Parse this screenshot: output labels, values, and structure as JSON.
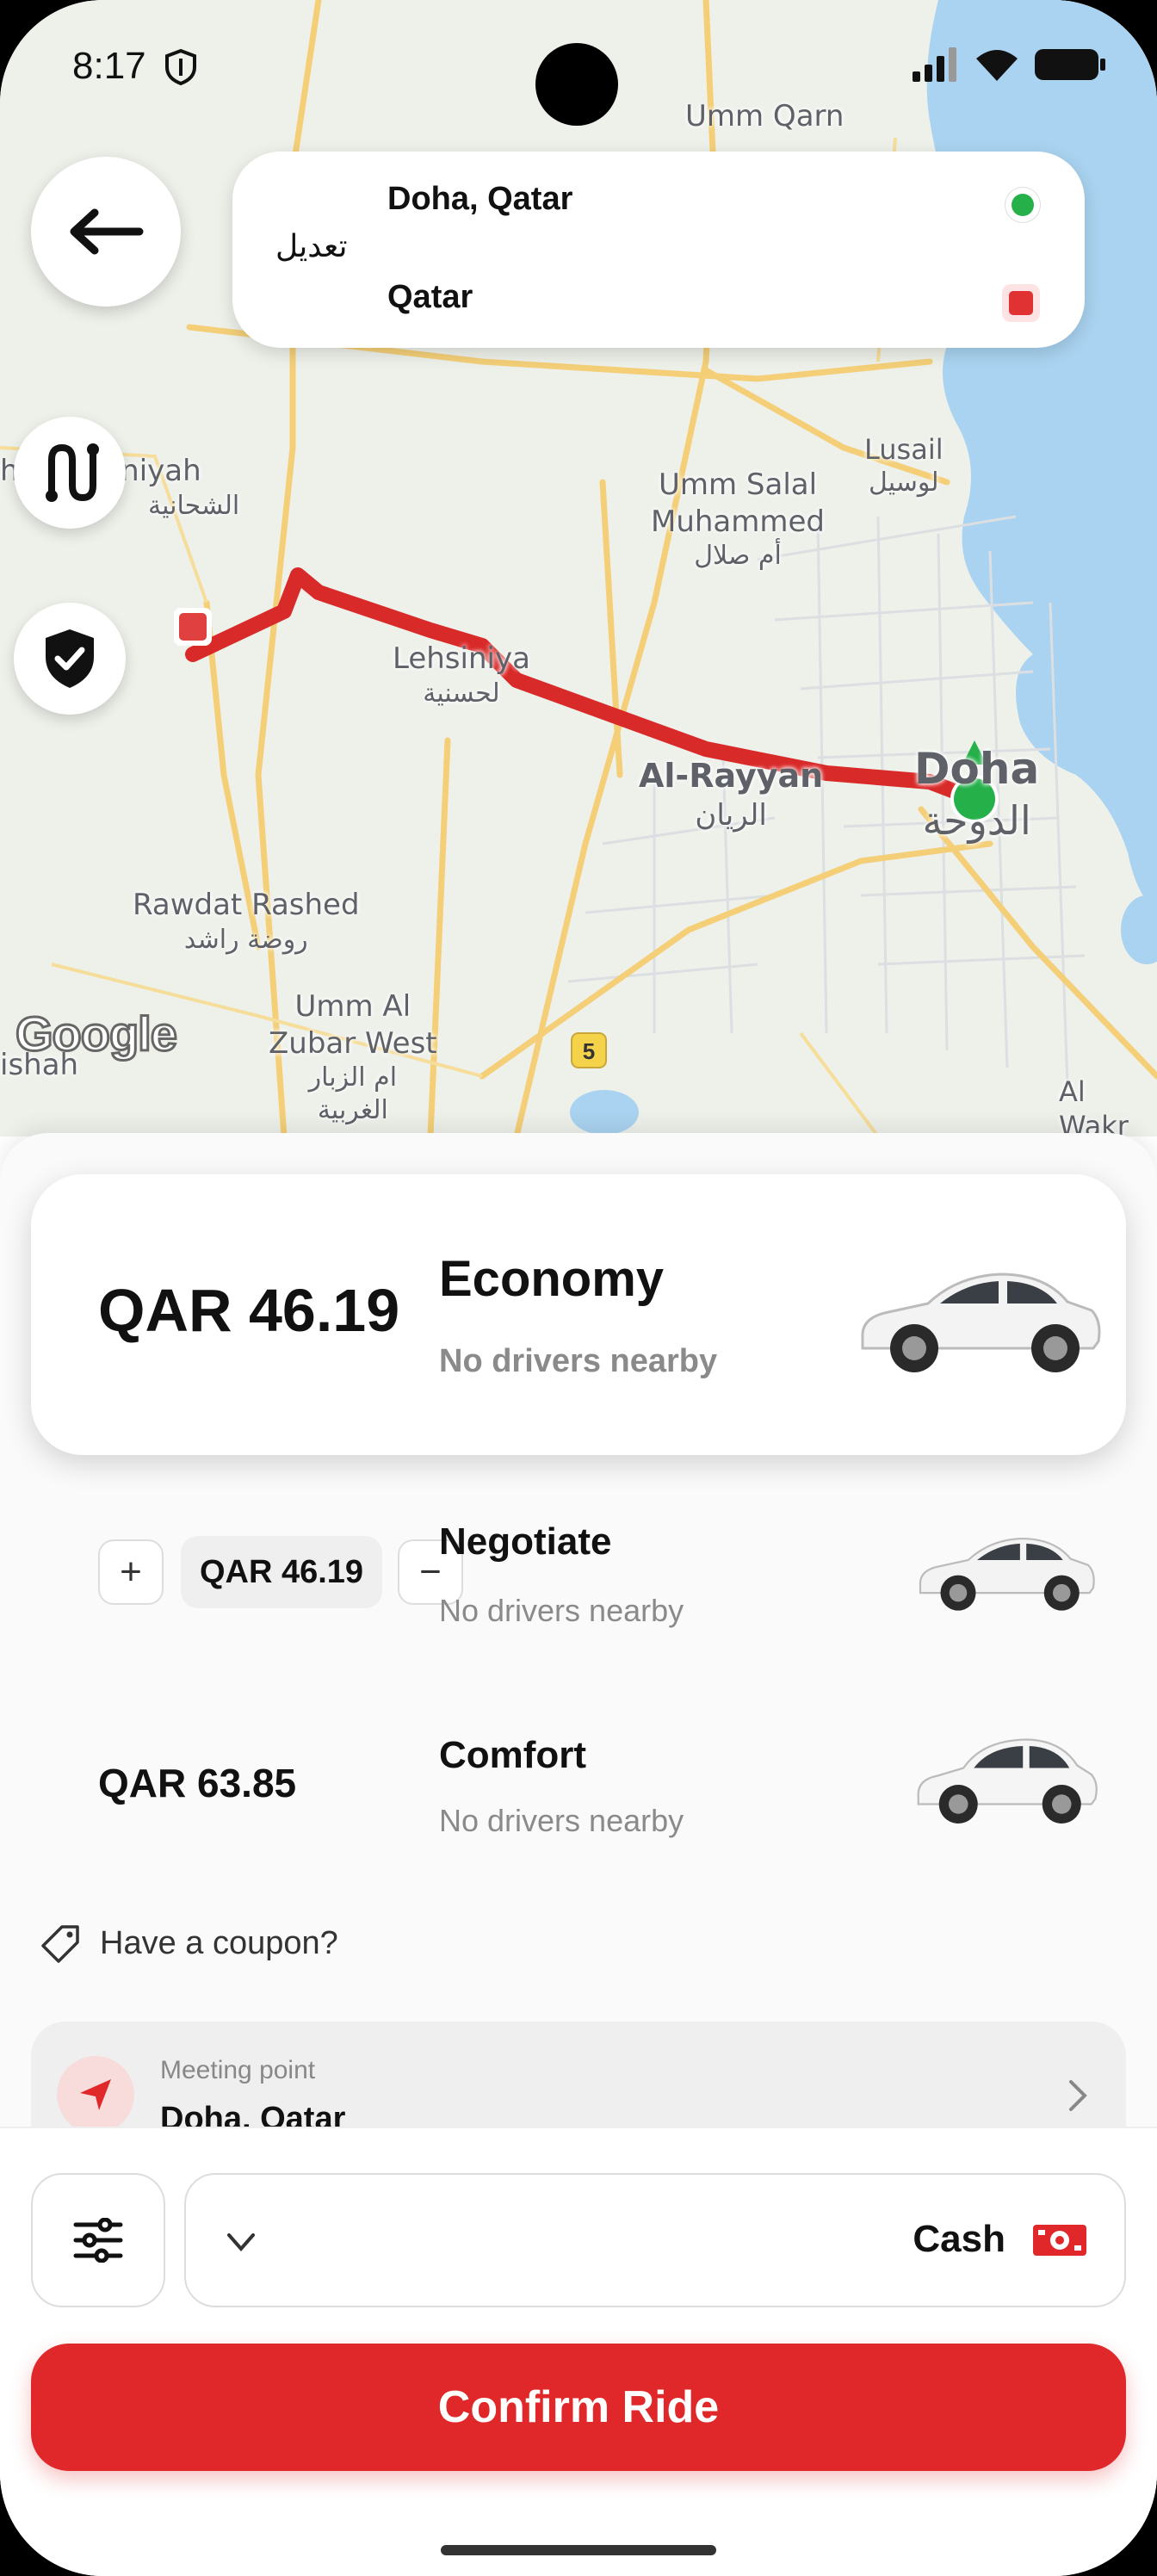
{
  "status_bar": {
    "time": "8:17"
  },
  "map": {
    "labels": {
      "umm_qarn": "Umm Qarn",
      "shahaniyah_en": "h-Shahaniyah",
      "shahaniyah_ar": "الشحانية",
      "lusail_en": "Lusail",
      "lusail_ar": "لوسيل",
      "umm_salal_en1": "Umm Salal",
      "umm_salal_en2": "Muhammed",
      "umm_salal_ar": "أم صلال",
      "lehsiniya_en": "Lehsiniya",
      "lehsiniya_ar": "لحسنية",
      "al_rayyan_en": "Al-Rayyan",
      "al_rayyan_ar": "الريان",
      "doha_en": "Doha",
      "doha_ar": "الدوحة",
      "rawdat_en": "Rawdat Rashed",
      "rawdat_ar": "روضة راشد",
      "umm_al_zubar_en1": "Umm Al",
      "umm_al_zubar_en2": "Zubar West",
      "umm_al_zubar_ar1": "ام الزبار",
      "umm_al_zubar_ar2": "الغربية",
      "ishah": "ishah",
      "al_wakra": "Al Wakr",
      "road_5": "5",
      "google": "Google"
    }
  },
  "route": {
    "edit_label": "تعديل",
    "from": "Doha, Qatar",
    "to": "Qatar"
  },
  "rides": {
    "economy": {
      "price": "QAR 46.19",
      "name": "Economy",
      "status": "No drivers nearby"
    },
    "negotiate": {
      "price": "QAR 46.19",
      "name": "Negotiate",
      "status": "No drivers nearby",
      "plus": "+",
      "minus": "−"
    },
    "comfort": {
      "price": "QAR 63.85",
      "name": "Comfort",
      "status": "No drivers nearby"
    }
  },
  "coupon": {
    "label": "Have a coupon?"
  },
  "meeting_point": {
    "label": "Meeting point",
    "value": "Doha, Qatar"
  },
  "payment": {
    "method": "Cash"
  },
  "confirm": {
    "label": "Confirm Ride"
  },
  "colors": {
    "accent": "#e0282a",
    "route": "#d92a2a",
    "origin": "#25b04a",
    "water": "#a9d3f0",
    "map_bg": "#eef0ea"
  }
}
